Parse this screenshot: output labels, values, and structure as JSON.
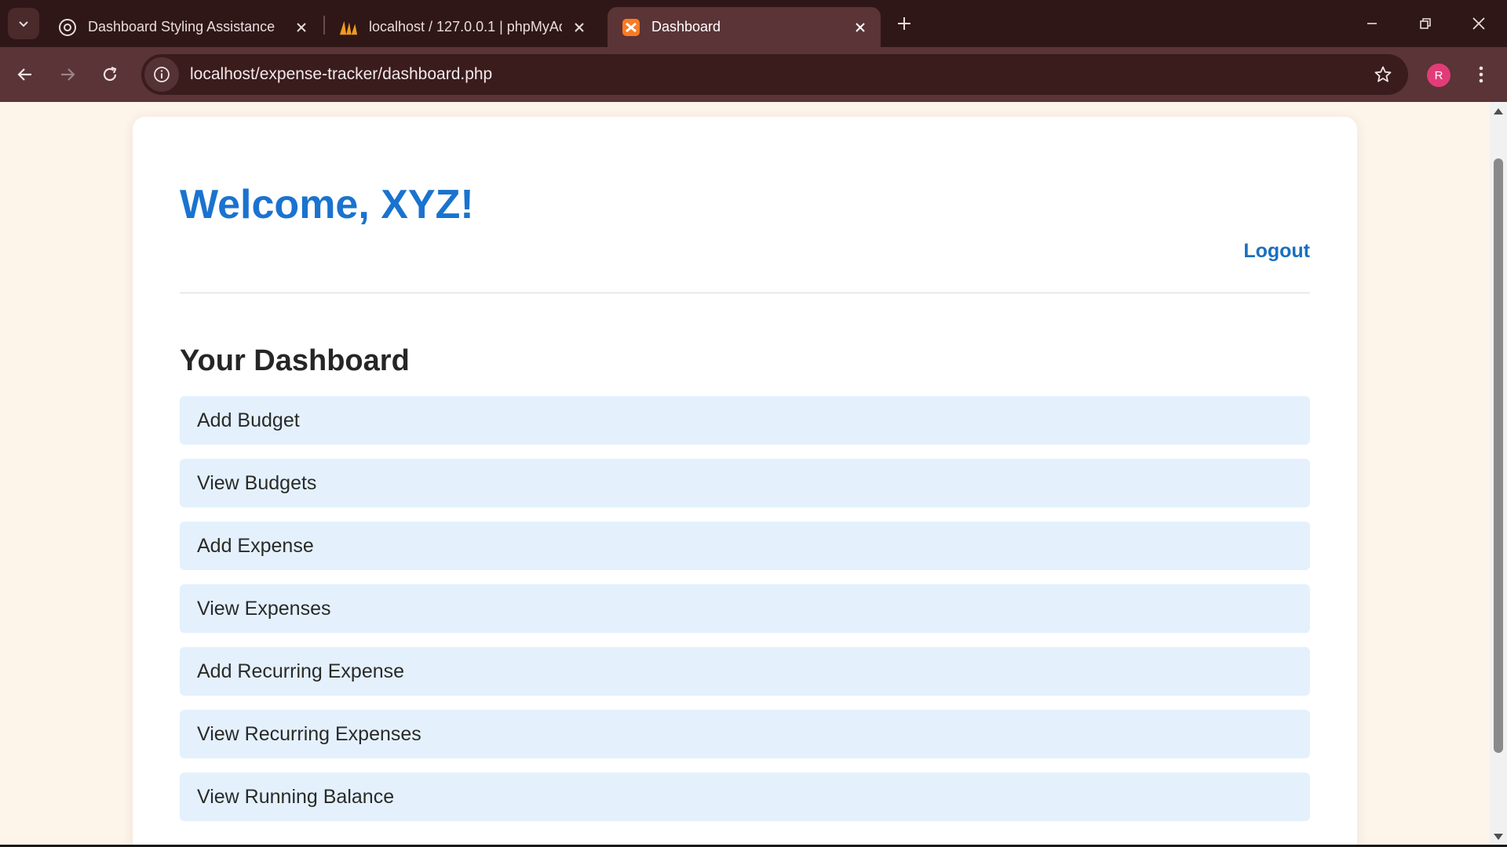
{
  "browser": {
    "tabs": [
      {
        "title": "Dashboard Styling Assistance",
        "icon": "chatgpt-icon",
        "active": false
      },
      {
        "title": "localhost / 127.0.0.1 | phpMyAd",
        "icon": "phpmyadmin-icon",
        "active": false
      },
      {
        "title": "Dashboard",
        "icon": "xampp-icon",
        "active": true
      }
    ],
    "url": "localhost/expense-tracker/dashboard.php",
    "profile_initial": "R",
    "colors": {
      "tabstrip": "#2f1718",
      "toolbar": "#5a3436",
      "profile": "#e23c78"
    }
  },
  "page": {
    "welcome": "Welcome, XYZ!",
    "logout_label": "Logout",
    "dashboard_title": "Your Dashboard",
    "menu_items": [
      {
        "label": "Add Budget"
      },
      {
        "label": "View Budgets"
      },
      {
        "label": "Add Expense"
      },
      {
        "label": "View Expenses"
      },
      {
        "label": "Add Recurring Expense"
      },
      {
        "label": "View Recurring Expenses"
      },
      {
        "label": "View Running Balance"
      }
    ],
    "colors": {
      "background": "#fdf4ea",
      "heading": "#1a73cf",
      "item_bg": "#e4f1fd",
      "link": "#1a6fc0"
    }
  }
}
